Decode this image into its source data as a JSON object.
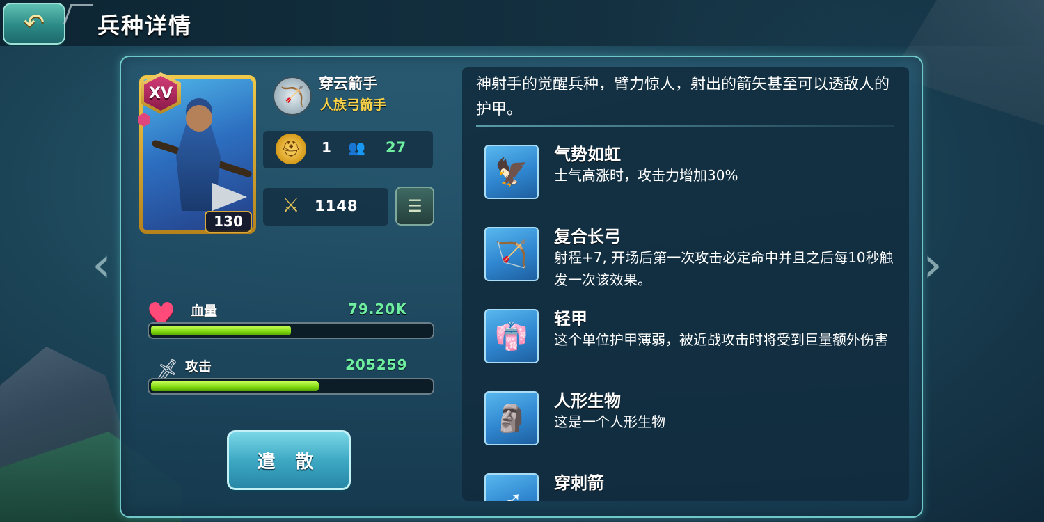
{
  "header": {
    "title": "兵种详情",
    "back_icon": "back-arrow-icon"
  },
  "unit": {
    "rank": "XV",
    "level": "130",
    "name": "穿云箭手",
    "subtitle": "人族弓箭手",
    "cost": "1",
    "troops": "27",
    "power": "1148"
  },
  "bars": {
    "hp": {
      "label": "血量",
      "value": "79.20K",
      "fill": 0.5
    },
    "attack": {
      "label": "攻击",
      "value": "205259",
      "fill": 0.6
    }
  },
  "disband_label": "遣 散",
  "description": "神射手的觉醒兵种，臂力惊人，射出的箭矢甚至可以透敌人的护甲。",
  "skills": [
    {
      "name": "气势如虹",
      "desc": "士气高涨时，攻击力增加30%",
      "icon": "morale-eagle-icon"
    },
    {
      "name": "复合长弓",
      "desc": "射程+7, 开场后第一次攻击必定命中并且之后每10秒触发一次该效果。",
      "icon": "composite-bow-icon"
    },
    {
      "name": "轻甲",
      "desc": "这个单位护甲薄弱，被近战攻击时将受到巨量额外伤害",
      "icon": "light-armor-icon"
    },
    {
      "name": "人形生物",
      "desc": "这是一个人形生物",
      "icon": "humanoid-icon"
    },
    {
      "name": "穿刺箭",
      "desc": "",
      "icon": "pierce-arrow-icon"
    }
  ],
  "colors": {
    "accent_green": "#6ff0a1",
    "gold": "#f7d24a",
    "panel_border": "#6fc7c8"
  }
}
